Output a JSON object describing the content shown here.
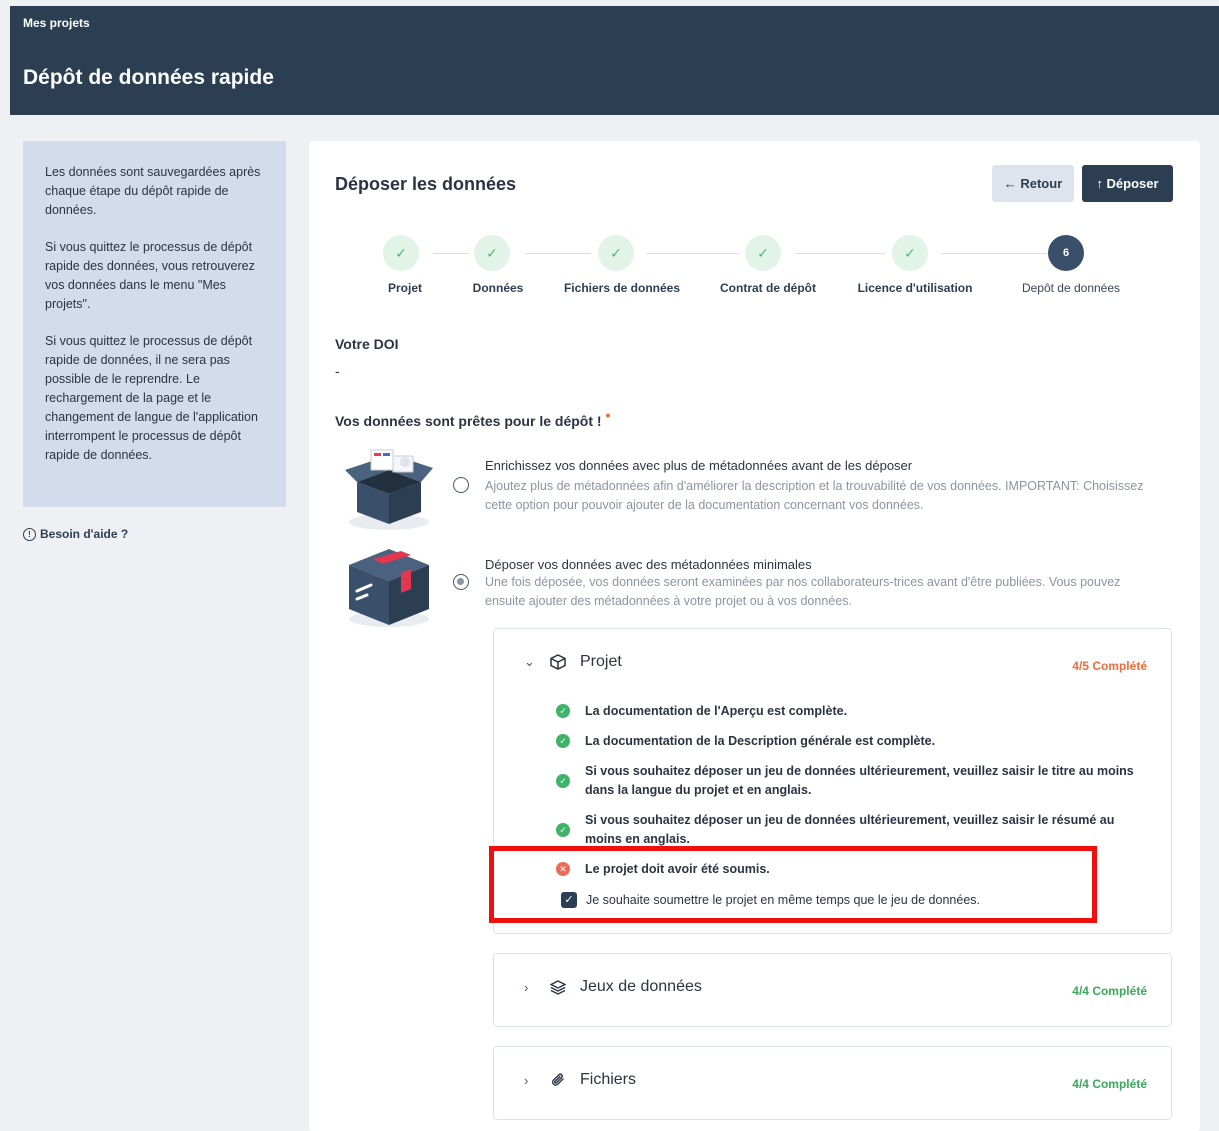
{
  "header": {
    "breadcrumb": "Mes projets",
    "title": "Dépôt de données rapide"
  },
  "sidebar": {
    "paragraphs": [
      "Les données sont sauvegardées après chaque étape du dépôt rapide de données.",
      "Si vous quittez le processus de dépôt rapide des données, vous retrouverez vos données dans le menu \"Mes projets\".",
      "Si vous quittez le processus de dépôt rapide de données, il ne sera pas possible de le reprendre. Le rechargement de la page et le changement de langue de l'application interrompent le processus de dépôt rapide de données."
    ],
    "help_label": "Besoin d'aide ?",
    "help_icon": "!"
  },
  "main": {
    "title": "Déposer les données",
    "back_label": "← Retour",
    "submit_label": "↑ Déposer",
    "steps": [
      {
        "label": "Projet",
        "state": "done",
        "mark": "✓"
      },
      {
        "label": "Données",
        "state": "done",
        "mark": "✓"
      },
      {
        "label": "Fichiers de données",
        "state": "done",
        "mark": "✓"
      },
      {
        "label": "Contrat de dépôt",
        "state": "done",
        "mark": "✓"
      },
      {
        "label": "Licence d'utilisation",
        "state": "done",
        "mark": "✓"
      },
      {
        "label": "Depôt de données",
        "state": "active",
        "mark": "6"
      }
    ],
    "doi_label": "Votre DOI",
    "doi_value": "-",
    "ready_title": "Vos données sont prêtes pour le dépôt !",
    "required_mark": "•",
    "options": [
      {
        "title": "Enrichissez vos données avec plus de métadonnées avant de les déposer",
        "description": "Ajoutez plus de métadonnées afin d'améliorer la description et la trouvabilité de vos données. IMPORTANT: Choisissez cette option pour pouvoir ajouter de la documentation concernant vos données.",
        "selected": false
      },
      {
        "title": "Déposer vos données avec des métadonnées minimales",
        "description": "Une fois déposée, vos données seront examinées par nos collaborateurs-trices avant d'être publiées. Vous pouvez ensuite ajouter des métadonnées à votre projet ou à vos données.",
        "selected": true
      }
    ],
    "sections": [
      {
        "title": "Projet",
        "status": "4/5 Complété",
        "expanded": true,
        "checks": [
          {
            "text": "La documentation de l'Aperçu est complète.",
            "ok": true,
            "mark": "✓"
          },
          {
            "text": "La documentation de la Description générale est complète.",
            "ok": true,
            "mark": "✓"
          },
          {
            "text": "Si vous souhaitez déposer un jeu de données ultérieurement, veuillez saisir le titre au moins dans la langue du projet et en anglais.",
            "ok": true,
            "mark": "✓"
          },
          {
            "text": "Si vous souhaitez déposer un jeu de données ultérieurement, veuillez saisir le résumé au moins en anglais.",
            "ok": true,
            "mark": "✓"
          },
          {
            "text": "Le projet doit avoir été soumis.",
            "ok": false,
            "mark": "✕"
          }
        ],
        "checkbox_label": "Je souhaite soumettre le projet en même temps que le jeu de données.",
        "checkbox_checked": true,
        "checkbox_mark": "✓"
      },
      {
        "title": "Jeux de données",
        "status": "4/4 Complété",
        "expanded": false
      },
      {
        "title": "Fichiers",
        "status": "4/4 Complété",
        "expanded": false
      }
    ],
    "chevrons": {
      "expanded": "⌄",
      "collapsed": "›"
    }
  },
  "colors": {
    "header_bg": "#2c3e52",
    "side_panel_bg": "#d2dcec",
    "success": "#3fb468",
    "warning": "#ee6b3b",
    "error": "#ec6b58",
    "highlight": "#ef0f0f"
  }
}
